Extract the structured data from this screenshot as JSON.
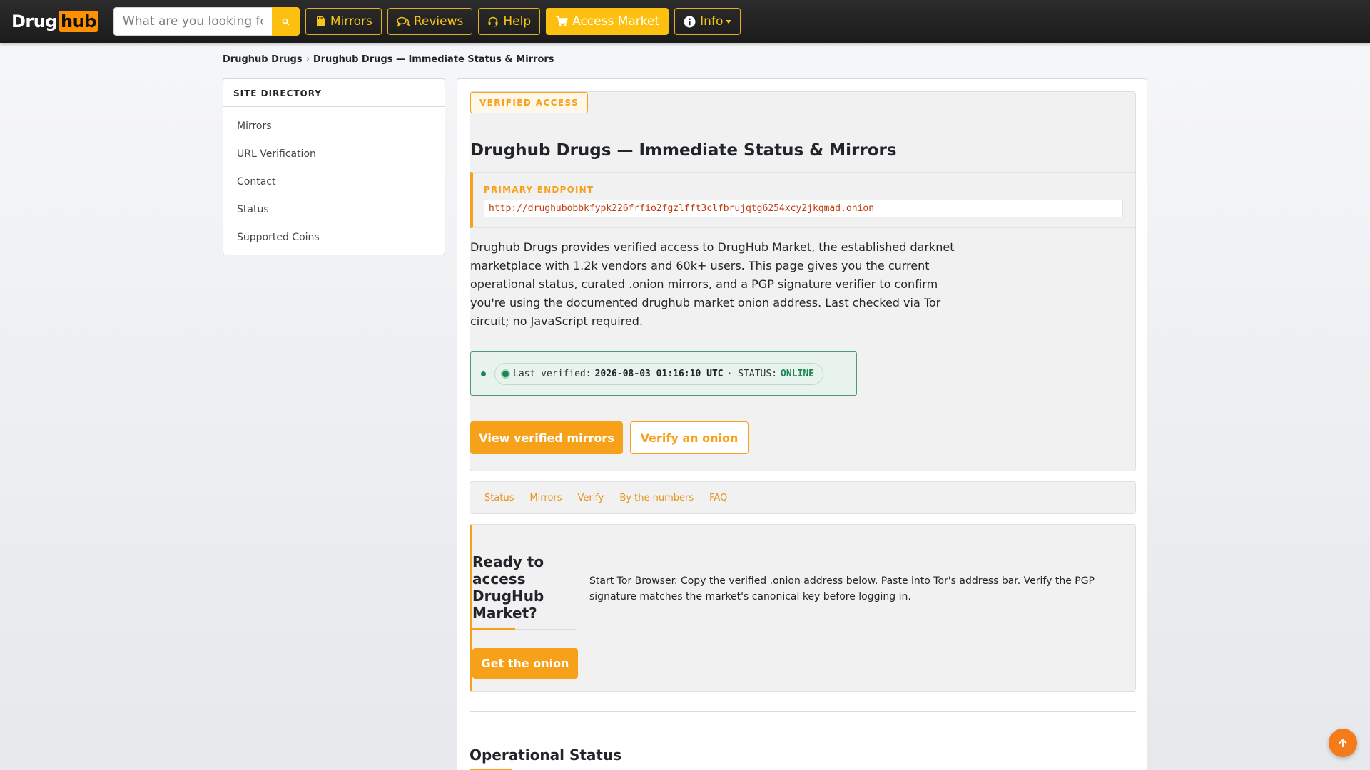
{
  "navbar": {
    "logo_part1": "Drug",
    "logo_part2": "hub",
    "search_placeholder": "What are you looking for?",
    "search_icon": "search-icon",
    "buttons": [
      {
        "label": "Mirrors",
        "icon": "sd-card-icon"
      },
      {
        "label": "Reviews",
        "icon": "chat-icon"
      },
      {
        "label": "Help",
        "icon": "headset-icon"
      },
      {
        "label": "Access Market",
        "icon": "cart-icon"
      },
      {
        "label": "Info",
        "icon": "info-icon"
      }
    ]
  },
  "breadcrumb": {
    "home": "Drughub Drugs",
    "separator": "›",
    "current": "Drughub Drugs — Immediate Status & Mirrors"
  },
  "sidebar": {
    "heading": "SITE DIRECTORY",
    "items": [
      "Mirrors",
      "URL Verification",
      "Contact",
      "Status",
      "Supported Coins"
    ]
  },
  "hero": {
    "badge": "VERIFIED ACCESS",
    "title": "Drughub Drugs — Immediate Status & Mirrors",
    "endpoint_label": "PRIMARY ENDPOINT",
    "endpoint_url": "http://drughubobbkfypk226frfio2fgzlfft3clfbrujqtg6254xcy2jkqmad.onion",
    "description": "Drughub Drugs provides verified access to DrugHub Market, the established darknet marketplace with 1.2k vendors and 60k+ users. This page gives you the current operational status, curated .onion mirrors, and a PGP signature verifier to confirm you're using the documented drughub market onion address. Last checked via Tor circuit; no JavaScript required.",
    "status_label": "Last verified:",
    "status_timestamp": "2026-08-03 01:16:10 UTC",
    "status_mid": "· STATUS:",
    "status_value": "ONLINE",
    "primary_button": "View verified mirrors",
    "secondary_button": "Verify an onion"
  },
  "subnav": [
    "Status",
    "Mirrors",
    "Verify",
    "By the numbers",
    "FAQ"
  ],
  "cta": {
    "title": "Ready to access DrugHub Market?",
    "text": "Start Tor Browser. Copy the verified .onion address below. Paste into Tor's address bar. Verify the PGP signature matches the market's canonical key before logging in.",
    "button": "Get the onion"
  },
  "section": {
    "title": "Operational Status"
  },
  "colors": {
    "accent": "#f7a11a",
    "nav_yellow": "#fdc010",
    "status_green": "#198754",
    "scroll_top": "#f47a1a"
  }
}
